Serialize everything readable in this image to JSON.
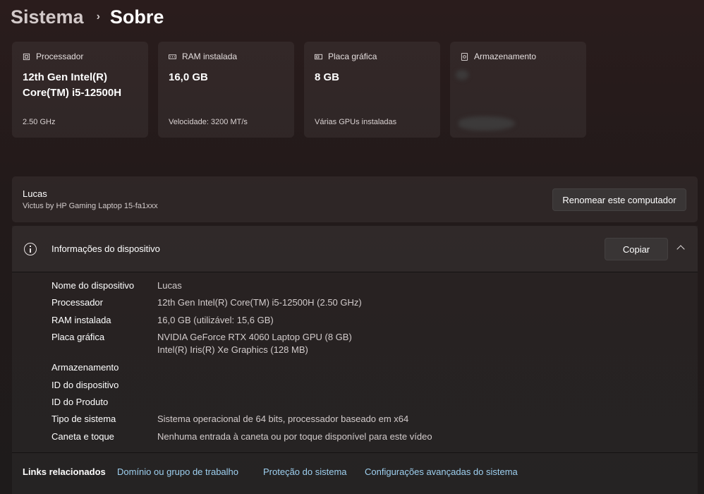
{
  "breadcrumb": {
    "parent": "Sistema",
    "separator": "›",
    "current": "Sobre"
  },
  "cards": [
    {
      "label": "Processador",
      "icon": "processor-icon",
      "value_line1": "12th Gen Intel(R)",
      "value_line2": "Core(TM) i5-12500H",
      "sub": "2.50 GHz"
    },
    {
      "label": "RAM instalada",
      "icon": "ram-icon",
      "value_line1": "16,0 GB",
      "value_line2": "",
      "sub": "Velocidade: 3200 MT/s"
    },
    {
      "label": "Placa gráfica",
      "icon": "gpu-icon",
      "value_line1": "8 GB",
      "value_line2": "",
      "sub": "Várias GPUs instaladas"
    },
    {
      "label": "Armazenamento",
      "icon": "storage-icon",
      "value_line1": "",
      "value_line2": "",
      "sub": ""
    }
  ],
  "computer": {
    "name": "Lucas",
    "model": "Victus by HP Gaming Laptop 15-fa1xxx",
    "rename_label": "Renomear este computador"
  },
  "device_info": {
    "title": "Informações do dispositivo",
    "copy_label": "Copiar",
    "rows": [
      {
        "label": "Nome do dispositivo",
        "value": "Lucas",
        "value2": ""
      },
      {
        "label": "Processador",
        "value": "12th Gen Intel(R) Core(TM) i5-12500H (2.50 GHz)",
        "value2": ""
      },
      {
        "label": "RAM instalada",
        "value": "16,0 GB (utilizável: 15,6 GB)",
        "value2": ""
      },
      {
        "label": "Placa gráfica",
        "value": "NVIDIA GeForce RTX 4060 Laptop GPU (8 GB)",
        "value2": "Intel(R) Iris(R) Xe Graphics (128 MB)"
      },
      {
        "label": "Armazenamento",
        "value": "",
        "value2": ""
      },
      {
        "label": "ID do dispositivo",
        "value": "",
        "value2": ""
      },
      {
        "label": "ID do Produto",
        "value": "",
        "value2": ""
      },
      {
        "label": "Tipo de sistema",
        "value": "Sistema operacional de 64 bits, processador baseado em x64",
        "value2": ""
      },
      {
        "label": "Caneta e toque",
        "value": "Nenhuma entrada à caneta ou por toque disponível para este vídeo",
        "value2": ""
      }
    ]
  },
  "related_links": {
    "title": "Links relacionados",
    "links": [
      "Domínio ou grupo de trabalho",
      "Proteção do sistema",
      "Configurações avançadas do sistema"
    ]
  }
}
